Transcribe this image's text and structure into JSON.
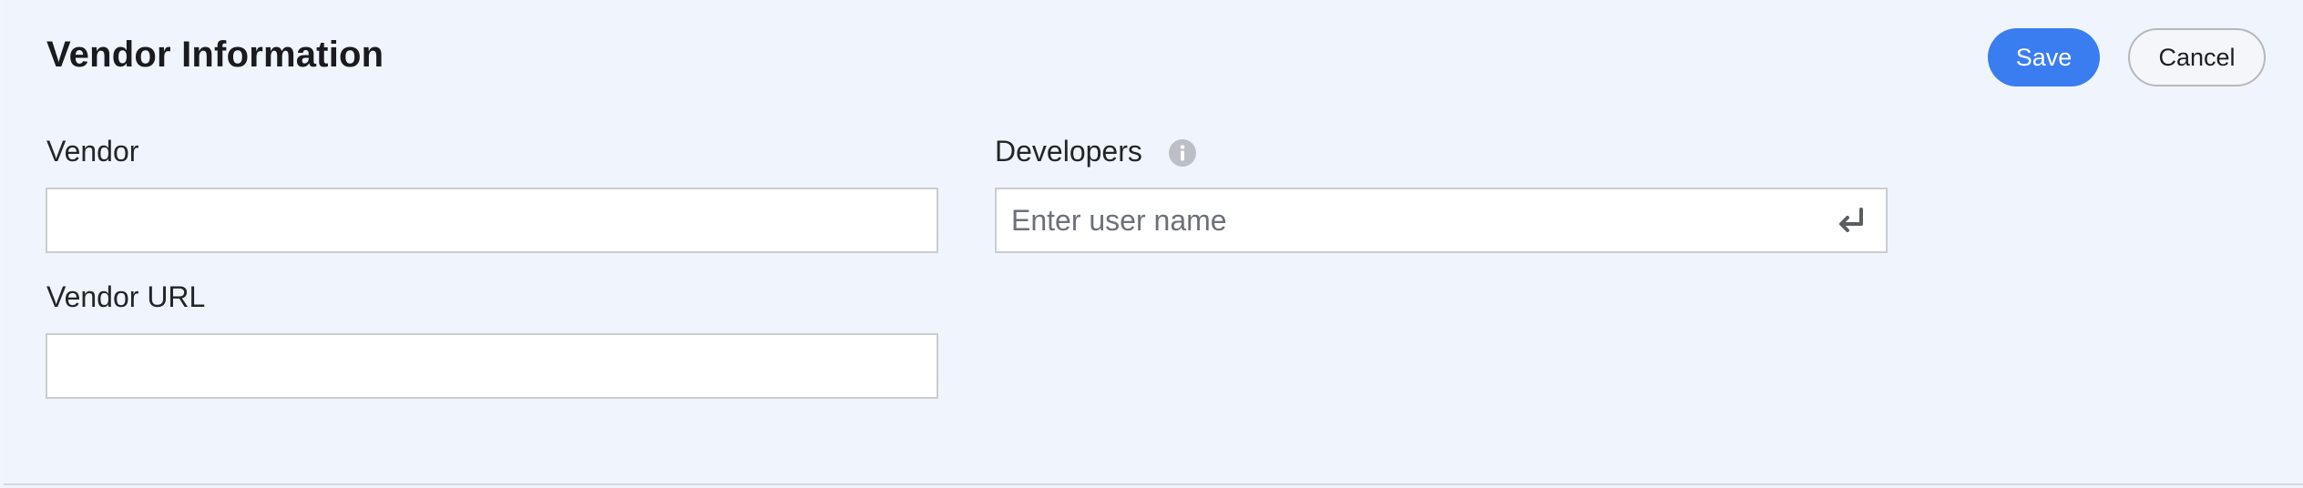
{
  "header": {
    "title": "Vendor Information",
    "save_label": "Save",
    "cancel_label": "Cancel"
  },
  "form": {
    "vendor": {
      "label": "Vendor",
      "value": "",
      "placeholder": ""
    },
    "vendor_url": {
      "label": "Vendor URL",
      "value": "",
      "placeholder": ""
    },
    "developers": {
      "label": "Developers",
      "value": "",
      "placeholder": "Enter user name",
      "info_icon": "info-icon",
      "submit_icon": "enter-return-icon"
    }
  },
  "colors": {
    "accent": "#3a7df0",
    "background": "#f0f5fd",
    "border": "#c9ccd1"
  }
}
